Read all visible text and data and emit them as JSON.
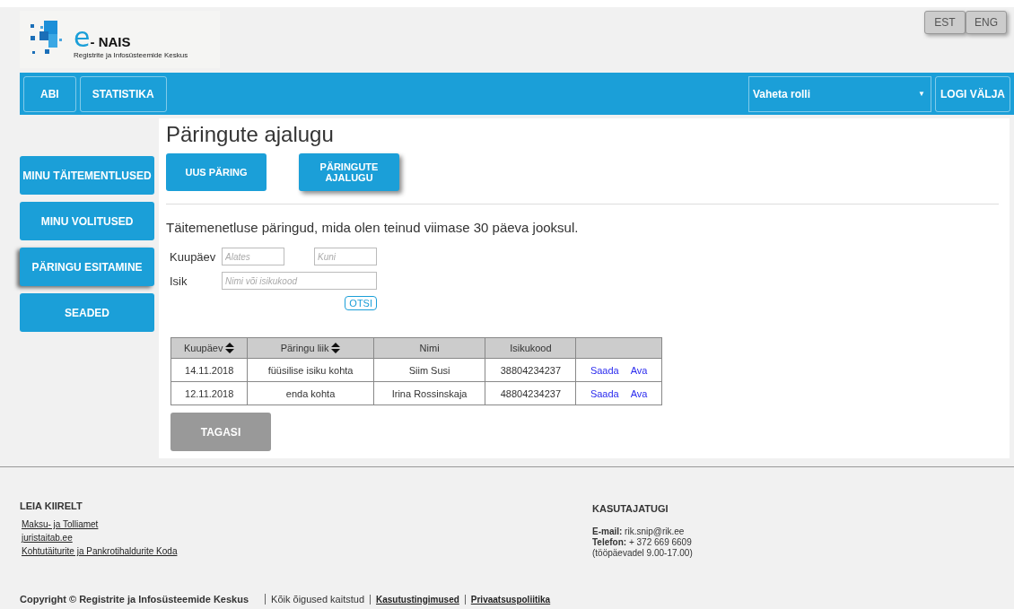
{
  "logo": {
    "brand": "e",
    "name": "- NAIS",
    "subtitle": "Registrite ja Infosüsteemide Keskus"
  },
  "languages": [
    "EST",
    "ENG"
  ],
  "navbar": {
    "buttons": [
      "ABI",
      "STATISTIKA"
    ],
    "role_select": {
      "value": "Vaheta rolli",
      "caret": "▼"
    },
    "logout": "LOGI VÄLJA"
  },
  "sidebar": {
    "items": [
      {
        "label": "MINU TÄITEMENTLUSED",
        "selected": false
      },
      {
        "label": "MINU VOLITUSED",
        "selected": false
      },
      {
        "label": "PÄRINGU ESITAMINE",
        "selected": true
      },
      {
        "label": "SEADED",
        "selected": false
      }
    ]
  },
  "page_title": "Päringute ajalugu",
  "tabs": [
    {
      "label": "UUS PÄRING",
      "selected": false
    },
    {
      "label": "PÄRINGUTE AJALUGU",
      "selected": true
    }
  ],
  "description": "Täitemenetluse päringud, mida olen teinud viimase 30 päeva jooksul.",
  "filters": {
    "date_label": "Kuupäev",
    "date_from_placeholder": "Alates",
    "date_to_placeholder": "Kuni",
    "person_label": "Isik",
    "person_placeholder": "Nimi või isikukood",
    "search_button": "OTSI"
  },
  "table": {
    "columns": [
      {
        "label": "Kuupäev",
        "sortable": true
      },
      {
        "label": "Päringu liik",
        "sortable": true
      },
      {
        "label": "Nimi",
        "sortable": false
      },
      {
        "label": "Isikukood",
        "sortable": false
      },
      {
        "sortable": false
      }
    ],
    "rows": [
      {
        "cells": [
          "14.11.2018",
          "füüsilise isiku kohta",
          "Siim Susi",
          "38804234237"
        ],
        "actions": [
          "Saada",
          "Ava"
        ]
      },
      {
        "cells": [
          "12.11.2018",
          "enda kohta",
          "Irina Rossinskaja",
          "48804234237"
        ],
        "actions": [
          "Saada",
          "Ava"
        ]
      }
    ]
  },
  "back_button": {
    "label": "TAGASI",
    "disabled": true
  },
  "footer": {
    "quick_links": {
      "title": "LEIA KIIRELT",
      "links": [
        "Maksu- ja Tolliamet",
        "juristaitab.ee",
        "Kohtutäiturite ja Pankrotihaldurite Koda"
      ]
    },
    "support": {
      "title": "KASUTAJATUGI",
      "lines": [
        "**E-mail:** rik.snip@rik.ee",
        "**Telefon:** + 372 669 6609",
        "(tööpäevadel 9.00-17.00)"
      ]
    },
    "copyright": "Copyright © Registrite ja Infosüsteemide Keskus",
    "bottom": [
      {
        "text": "Kõik õigused kaitstud",
        "kind": "text"
      },
      {
        "text": "Kasutustingimused",
        "kind": "link"
      },
      {
        "text": "Privaatsuspoliitika",
        "kind": "link"
      }
    ]
  }
}
